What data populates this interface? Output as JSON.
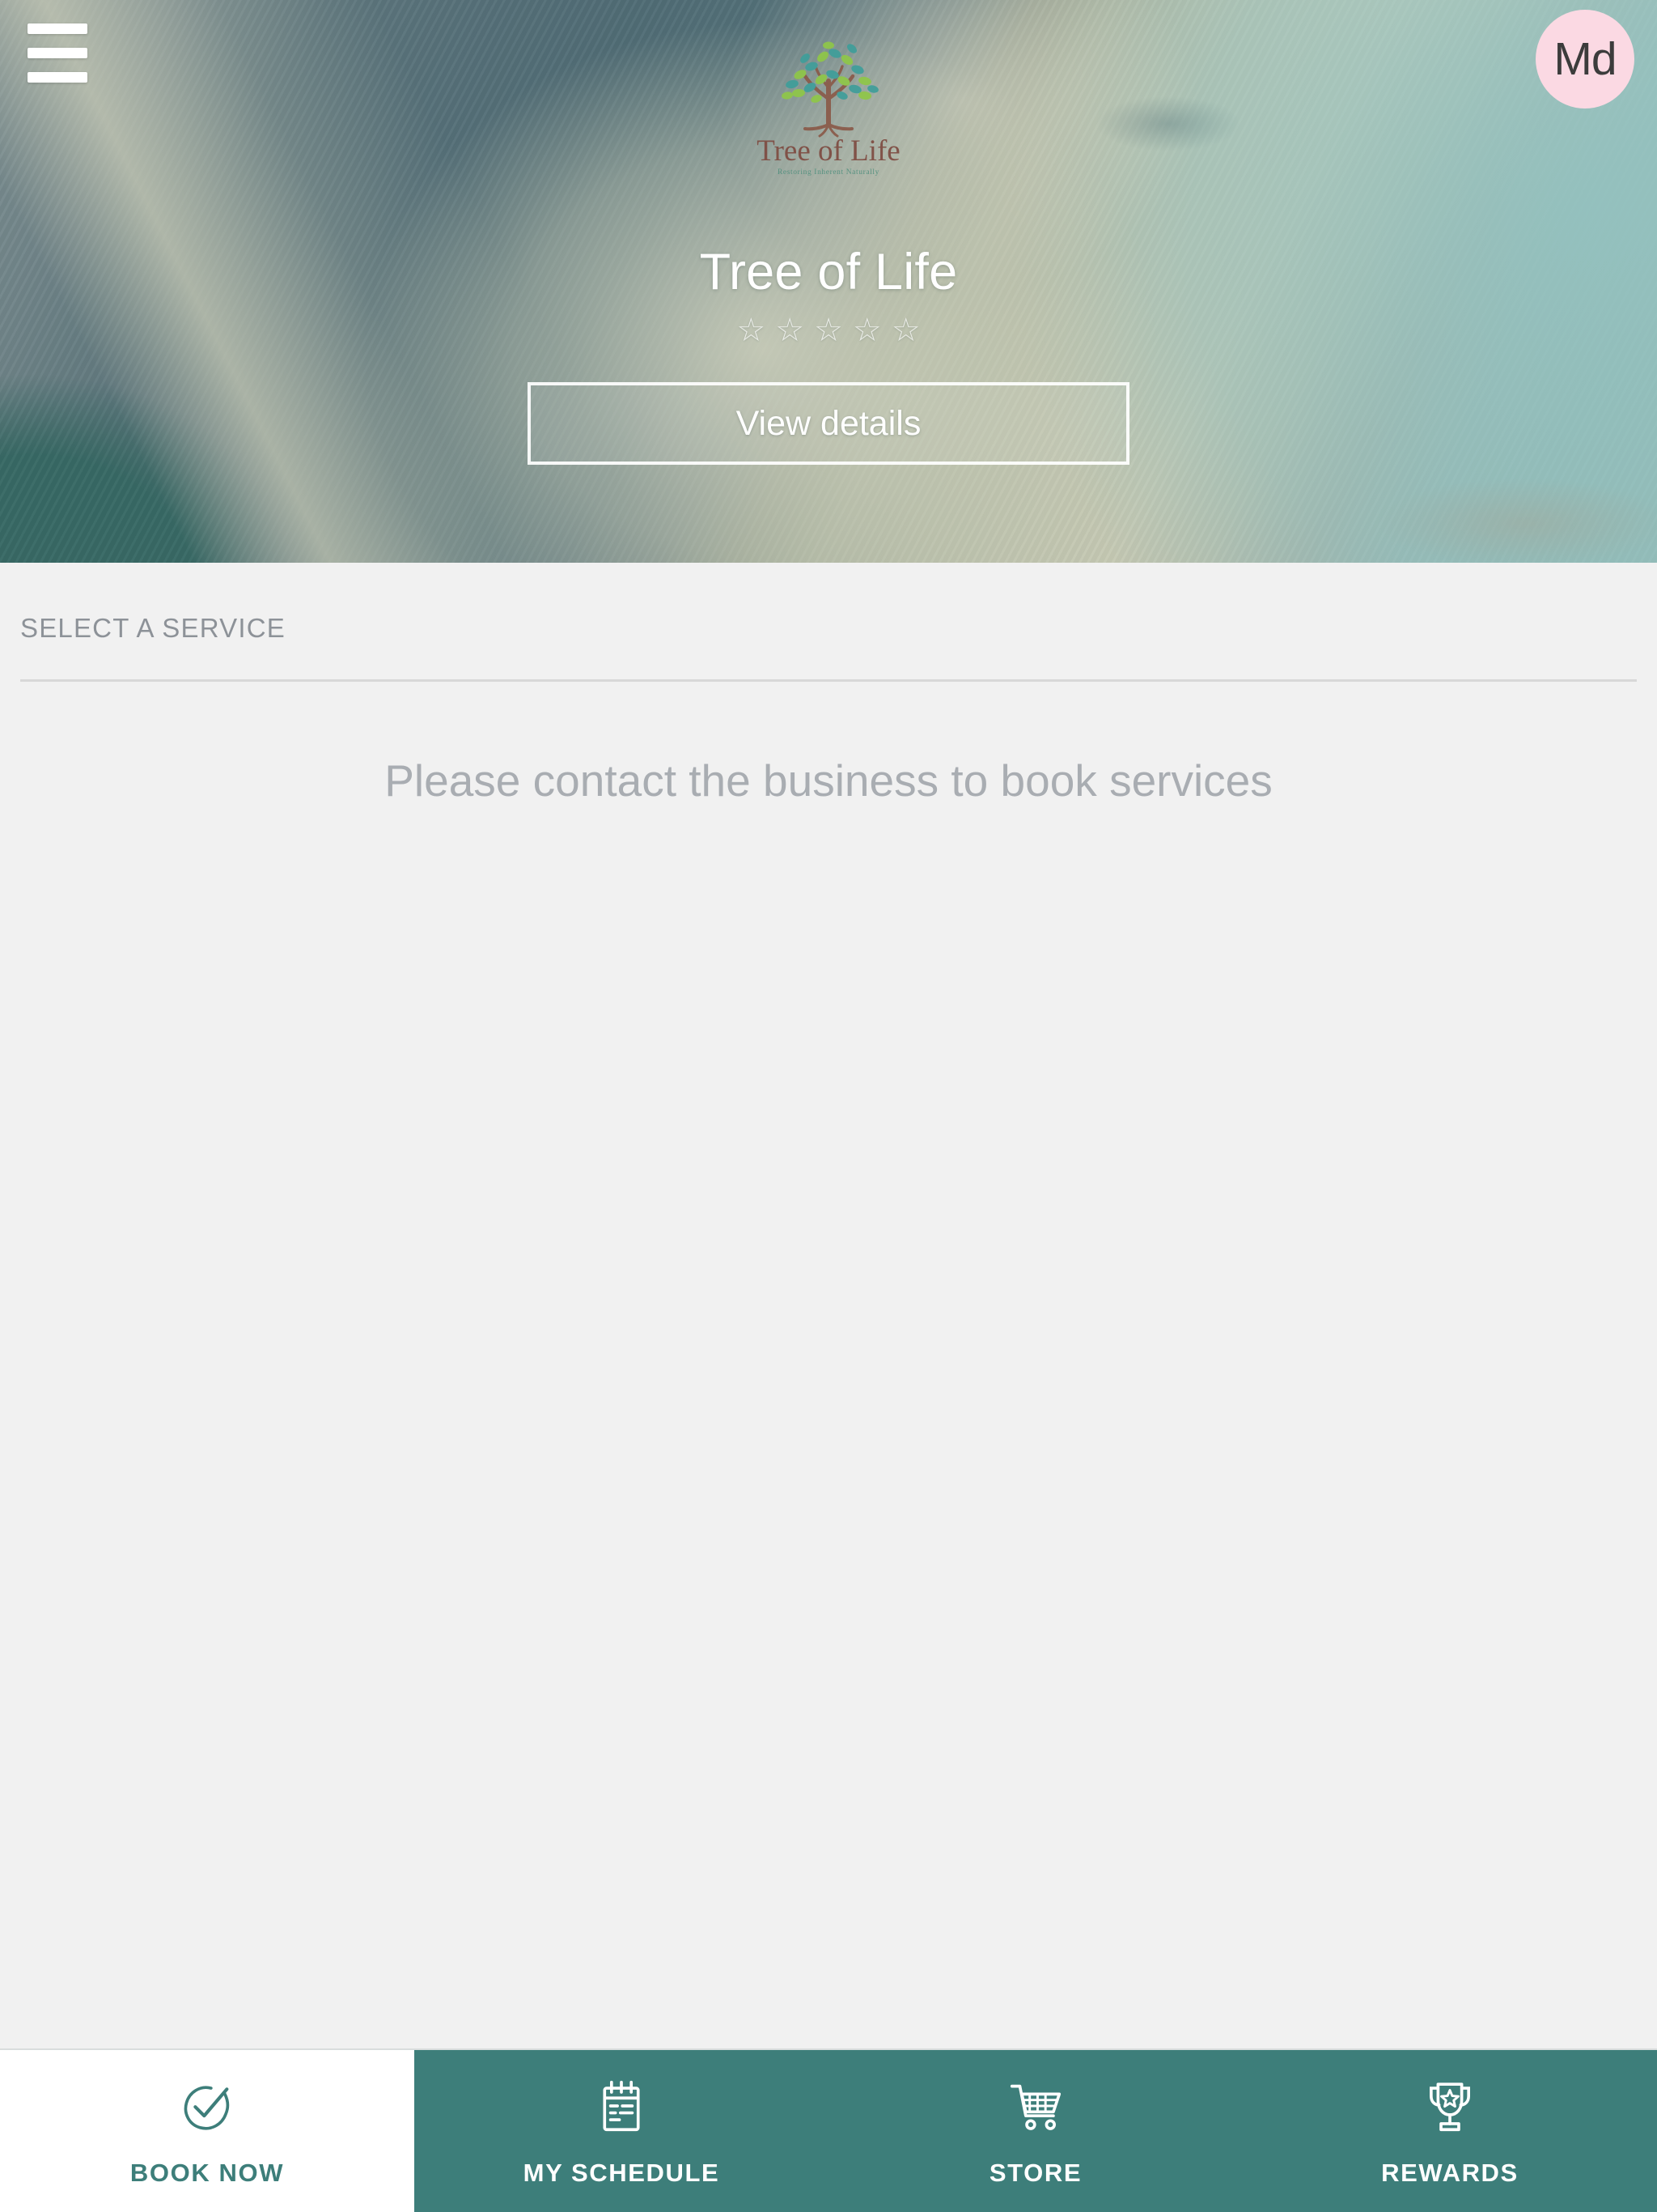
{
  "header": {
    "menu_icon": "hamburger-menu-icon",
    "avatar_initials": "Md",
    "avatar_bg": "#fbd9e3"
  },
  "hero": {
    "logo": {
      "name": "tree-of-life-logo",
      "wordmark": "Tree of Life",
      "tagline": "Restoring Inherent Naturally"
    },
    "business_name": "Tree of Life",
    "rating": {
      "stars_total": 5,
      "stars_filled": 0,
      "star_glyph": "☆"
    },
    "view_details_label": "View details"
  },
  "main": {
    "section_title": "SELECT A SERVICE",
    "empty_message": "Please contact the business to book services"
  },
  "bottom_nav": {
    "active_index": 0,
    "items": [
      {
        "label": "BOOK NOW",
        "icon": "check-circle-icon",
        "active": true
      },
      {
        "label": "MY SCHEDULE",
        "icon": "calendar-notepad-icon",
        "active": false
      },
      {
        "label": "STORE",
        "icon": "shopping-cart-icon",
        "active": false
      },
      {
        "label": "REWARDS",
        "icon": "trophy-star-icon",
        "active": false
      }
    ]
  },
  "colors": {
    "teal": "#3d7e7a",
    "hero_teal": "#9ac5c3",
    "page_bg": "#f1f1f1",
    "muted_text": "#a9adb2",
    "section_title": "#8d9298",
    "avatar_pink": "#fbd9e3"
  }
}
